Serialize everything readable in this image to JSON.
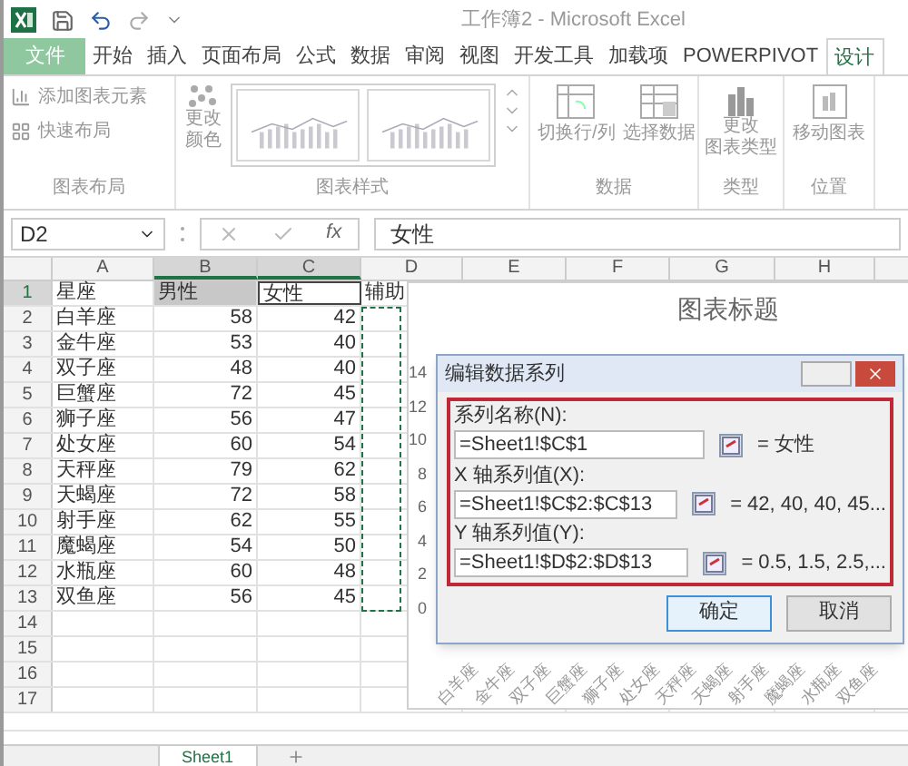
{
  "title_bar": {
    "title": "工作簿2 - Microsoft Excel"
  },
  "ribbon_tabs": [
    {
      "label": "文件",
      "kind": "file",
      "selected": false
    },
    {
      "label": "开始",
      "kind": "tab",
      "selected": false
    },
    {
      "label": "插入",
      "kind": "tab",
      "selected": false
    },
    {
      "label": "页面布局",
      "kind": "tab",
      "selected": false
    },
    {
      "label": "公式",
      "kind": "tab",
      "selected": false
    },
    {
      "label": "数据",
      "kind": "tab",
      "selected": false
    },
    {
      "label": "审阅",
      "kind": "tab",
      "selected": false
    },
    {
      "label": "视图",
      "kind": "tab",
      "selected": false
    },
    {
      "label": "开发工具",
      "kind": "tab",
      "selected": false
    },
    {
      "label": "加载项",
      "kind": "tab",
      "selected": false
    },
    {
      "label": "POWERPIVOT",
      "kind": "tab",
      "selected": false
    },
    {
      "label": "设计",
      "kind": "tab",
      "selected": true
    }
  ],
  "ribbon": {
    "chart_layout": {
      "label": "图表布局",
      "add_element": "添加图表元素",
      "quick_layout": "快速布局"
    },
    "chart_styles": {
      "label": "图表样式",
      "change_colors": [
        "更改",
        "颜色"
      ]
    },
    "data": {
      "label": "数据",
      "switch_row_column": "切换行/列",
      "select_data": "选择数据"
    },
    "type": {
      "label": "类型",
      "change_type": [
        "更改",
        "图表类型"
      ]
    },
    "location": {
      "label": "位置",
      "move_chart": "移动图表"
    }
  },
  "formula_bar": {
    "name_box": "D2",
    "function_label": "fx",
    "value": "女性"
  },
  "sheet": {
    "columns": [
      {
        "label": "A",
        "selected": false
      },
      {
        "label": "B",
        "selected": true
      },
      {
        "label": "C",
        "selected": true
      },
      {
        "label": "D",
        "selected": false
      },
      {
        "label": "E",
        "selected": false
      },
      {
        "label": "F",
        "selected": false
      },
      {
        "label": "G",
        "selected": false
      },
      {
        "label": "H",
        "selected": false
      }
    ],
    "rows": [
      {
        "header": "1",
        "selected": true,
        "cells": [
          {
            "text": "星座",
            "shaded": false,
            "outlined": false
          },
          {
            "text": "男性",
            "shaded": true,
            "outlined": false
          },
          {
            "text": "女性",
            "shaded": false,
            "outlined": true
          },
          {
            "text": "辅助",
            "shaded": false,
            "outlined": false
          }
        ]
      },
      {
        "header": "2",
        "selected": false,
        "cells": [
          "白羊座",
          "58",
          "42"
        ]
      },
      {
        "header": "3",
        "selected": false,
        "cells": [
          "金牛座",
          "53",
          "40"
        ]
      },
      {
        "header": "4",
        "selected": false,
        "cells": [
          "双子座",
          "48",
          "40"
        ]
      },
      {
        "header": "5",
        "selected": false,
        "cells": [
          "巨蟹座",
          "72",
          "45"
        ]
      },
      {
        "header": "6",
        "selected": false,
        "cells": [
          "狮子座",
          "56",
          "47"
        ]
      },
      {
        "header": "7",
        "selected": false,
        "cells": [
          "处女座",
          "60",
          "54"
        ]
      },
      {
        "header": "8",
        "selected": false,
        "cells": [
          "天秤座",
          "79",
          "62"
        ]
      },
      {
        "header": "9",
        "selected": false,
        "cells": [
          "天蝎座",
          "72",
          "58"
        ]
      },
      {
        "header": "10",
        "selected": false,
        "cells": [
          "射手座",
          "62",
          "55"
        ]
      },
      {
        "header": "11",
        "selected": false,
        "cells": [
          "魔蝎座",
          "54",
          "50"
        ]
      },
      {
        "header": "12",
        "selected": false,
        "cells": [
          "水瓶座",
          "60",
          "48"
        ]
      },
      {
        "header": "13",
        "selected": false,
        "cells": [
          "双鱼座",
          "56",
          "45"
        ]
      },
      {
        "header": "14",
        "selected": false,
        "cells": []
      },
      {
        "header": "15",
        "selected": false,
        "cells": []
      },
      {
        "header": "16",
        "selected": false,
        "cells": []
      },
      {
        "header": "17",
        "selected": false,
        "cells": []
      }
    ]
  },
  "chart": {
    "title": "图表标题",
    "y_labels": [
      "14",
      "12",
      "10",
      "8",
      "6",
      "4",
      "2",
      "0"
    ],
    "x_labels": [
      "白羊座",
      "金牛座",
      "双子座",
      "巨蟹座",
      "狮子座",
      "处女座",
      "天秤座",
      "天蝎座",
      "射手座",
      "魔蝎座",
      "水瓶座",
      "双鱼座"
    ]
  },
  "dialog": {
    "title": "编辑数据系列",
    "fields": [
      {
        "label": "系列名称(N):",
        "value": "=Sheet1!$C$1",
        "result": "= 女性"
      },
      {
        "label": "X 轴系列值(X):",
        "value": "=Sheet1!$C$2:$C$13",
        "result": "= 42, 40, 40, 45..."
      },
      {
        "label": "Y 轴系列值(Y):",
        "value": "=Sheet1!$D$2:$D$13",
        "result": "= 0.5, 1.5, 2.5,..."
      }
    ],
    "buttons": [
      {
        "label": "确定",
        "kind": "default"
      },
      {
        "label": "取消",
        "kind": "normal"
      }
    ]
  },
  "sheet_tabs": [
    {
      "label": "Sheet1",
      "selected": true
    }
  ]
}
